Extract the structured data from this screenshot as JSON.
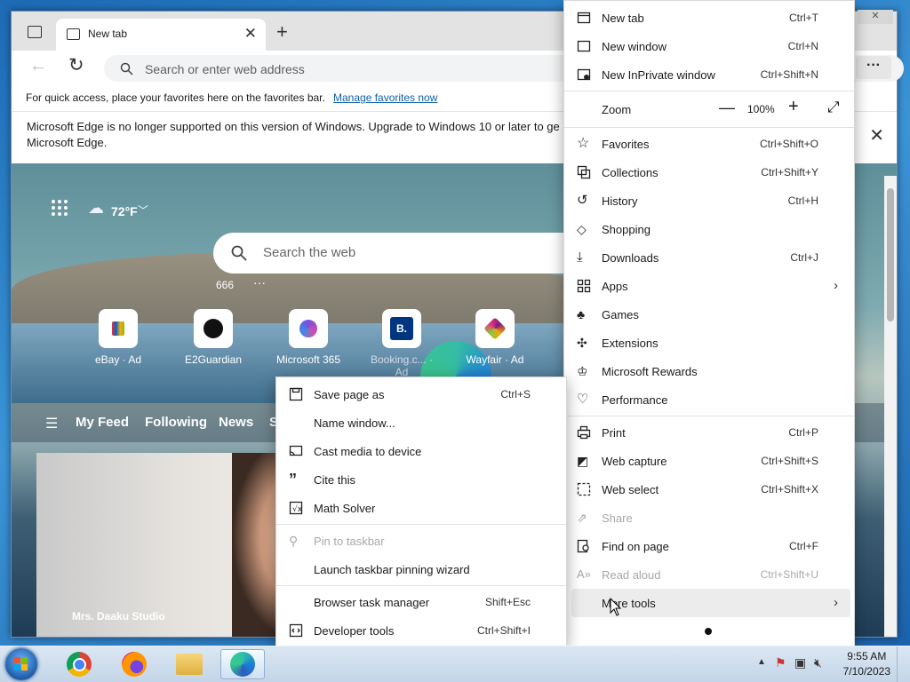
{
  "browser": {
    "tab_title": "New tab",
    "address_placeholder": "Search or enter web address",
    "favorites_bar_text": "For quick access, place your favorites here on the favorites bar.",
    "favorites_bar_link": "Manage favorites now",
    "info_message": "Microsoft Edge is no longer supported on this version of Windows. Upgrade to Windows 10 or later to ge Microsoft Edge."
  },
  "newtab": {
    "weather": "72°F",
    "search_placeholder": "Search the web",
    "counter": "666",
    "quick_links": [
      {
        "label": "eBay · Ad"
      },
      {
        "label": "E2Guardian"
      },
      {
        "label": "Microsoft 365"
      },
      {
        "label": "Booking.c... · Ad"
      },
      {
        "label": "Wayfair · Ad"
      }
    ],
    "feed_tabs": [
      "My Feed",
      "Following",
      "News",
      "S"
    ],
    "card_caption": "Mrs. Daaku Studio"
  },
  "menu": {
    "new_tab": {
      "label": "New tab",
      "shortcut": "Ctrl+T"
    },
    "new_window": {
      "label": "New window",
      "shortcut": "Ctrl+N"
    },
    "new_inprivate": {
      "label": "New InPrivate window",
      "shortcut": "Ctrl+Shift+N"
    },
    "zoom": {
      "label": "Zoom",
      "value": "100%"
    },
    "favorites": {
      "label": "Favorites",
      "shortcut": "Ctrl+Shift+O"
    },
    "collections": {
      "label": "Collections",
      "shortcut": "Ctrl+Shift+Y"
    },
    "history": {
      "label": "History",
      "shortcut": "Ctrl+H"
    },
    "shopping": {
      "label": "Shopping"
    },
    "downloads": {
      "label": "Downloads",
      "shortcut": "Ctrl+J"
    },
    "apps": {
      "label": "Apps"
    },
    "games": {
      "label": "Games"
    },
    "extensions": {
      "label": "Extensions"
    },
    "rewards": {
      "label": "Microsoft Rewards"
    },
    "performance": {
      "label": "Performance"
    },
    "print": {
      "label": "Print",
      "shortcut": "Ctrl+P"
    },
    "web_capture": {
      "label": "Web capture",
      "shortcut": "Ctrl+Shift+S"
    },
    "web_select": {
      "label": "Web select",
      "shortcut": "Ctrl+Shift+X"
    },
    "share": {
      "label": "Share"
    },
    "find": {
      "label": "Find on page",
      "shortcut": "Ctrl+F"
    },
    "read_aloud": {
      "label": "Read aloud",
      "shortcut": "Ctrl+Shift+U"
    },
    "more_tools": {
      "label": "More tools"
    }
  },
  "submenu": {
    "save_page": {
      "label": "Save page as",
      "shortcut": "Ctrl+S"
    },
    "name_window": {
      "label": "Name window..."
    },
    "cast": {
      "label": "Cast media to device"
    },
    "cite": {
      "label": "Cite this"
    },
    "math": {
      "label": "Math Solver"
    },
    "pin": {
      "label": "Pin to taskbar"
    },
    "pin_wizard": {
      "label": "Launch taskbar pinning wizard"
    },
    "task_manager": {
      "label": "Browser task manager",
      "shortcut": "Shift+Esc"
    },
    "dev_tools": {
      "label": "Developer tools",
      "shortcut": "Ctrl+Shift+I"
    }
  },
  "taskbar": {
    "time": "9:55 AM",
    "date": "7/10/2023"
  }
}
